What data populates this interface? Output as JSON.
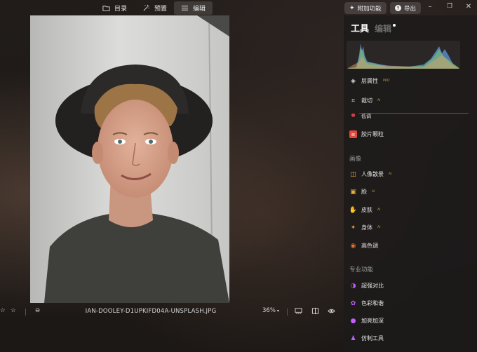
{
  "topbar": {
    "tabs": [
      {
        "label": "目录",
        "icon": "folder-icon"
      },
      {
        "label": "预置",
        "icon": "sparkle-wand-icon"
      },
      {
        "label": "编辑",
        "icon": "sliders-icon",
        "active": true
      }
    ],
    "addons_label": "附加功能",
    "export_label": "导出"
  },
  "bottombar": {
    "filename": "IAN-DOOLEY-D1UPKIFD04A-UNSPLASH.JPG",
    "zoom": "36%"
  },
  "panel": {
    "tab_tools": "工具",
    "tab_edit": "编辑",
    "items_top": [
      {
        "label": "层属性",
        "badge": "PRO",
        "icon": "layers-icon",
        "color": "#dcdcdc"
      },
      {
        "label": "裁切",
        "badge": "AI",
        "icon": "crop-icon",
        "color": "#dcdcdc"
      }
    ],
    "cut_item": {
      "label": "低调",
      "icon": "circle-icon"
    },
    "grain_item": {
      "label": "胶片颗粒",
      "icon": "film-icon",
      "color": "#e0483e"
    },
    "section_portrait": "画像",
    "portrait_items": [
      {
        "label": "人像散景",
        "badge": "AI",
        "icon": "portrait-bokeh-icon",
        "color": "#e8b23a"
      },
      {
        "label": "脸",
        "badge": "AI",
        "icon": "face-icon",
        "color": "#e8b23a"
      },
      {
        "label": "皮肤",
        "badge": "AI",
        "icon": "hand-icon",
        "color": "#e8a23a"
      },
      {
        "label": "身体",
        "badge": "AI",
        "icon": "body-icon",
        "color": "#e8902a"
      },
      {
        "label": "高色调",
        "icon": "high-key-icon",
        "color": "#e8702a"
      }
    ],
    "section_pro": "专业功能",
    "pro_items": [
      {
        "label": "超强对比",
        "icon": "contrast-icon",
        "color": "#c65cff"
      },
      {
        "label": "色彩和谐",
        "icon": "flower-icon",
        "color": "#c65cff"
      },
      {
        "label": "加亮加深",
        "icon": "drop-icon",
        "color": "#c65cff"
      },
      {
        "label": "仿制工具",
        "icon": "stamp-icon",
        "color": "#c65cff"
      }
    ]
  }
}
